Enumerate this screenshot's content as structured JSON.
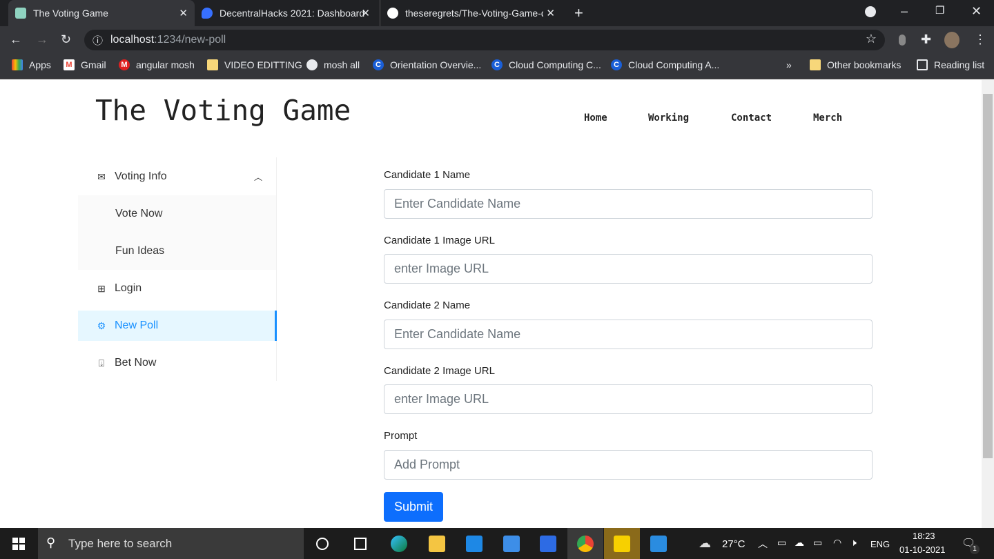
{
  "browser": {
    "tabs": [
      {
        "title": "The Voting Game",
        "active": true,
        "icon": "notion-icon"
      },
      {
        "title": "DecentralHacks 2021: Dashboard",
        "icon": "devfolio-icon"
      },
      {
        "title": "theseregrets/The-Voting-Game-d",
        "icon": "github-icon"
      }
    ],
    "url_host": "localhost",
    "url_path": ":1234/new-poll",
    "bookmarks": [
      "Apps",
      "Gmail",
      "angular mosh",
      "VIDEO EDITTING",
      "mosh all",
      "Orientation Overvie...",
      "Cloud Computing C...",
      "Cloud Computing A..."
    ],
    "other_bookmarks": "Other bookmarks",
    "reading_list": "Reading list",
    "overflow": "»"
  },
  "header": {
    "title": "The Voting Game",
    "nav": [
      "Home",
      "Working",
      "Contact",
      "Merch"
    ]
  },
  "sidebar": {
    "voting_info": "Voting Info",
    "sub_items": [
      "Vote Now",
      "Fun Ideas"
    ],
    "login": "Login",
    "new_poll": "New Poll",
    "bet_now": "Bet Now",
    "selected": "New Poll",
    "accent": "#1890ff"
  },
  "form": {
    "fields": [
      {
        "label": "Candidate 1 Name",
        "placeholder": "Enter Candidate Name"
      },
      {
        "label": "Candidate 1 Image URL",
        "placeholder": "enter Image URL"
      },
      {
        "label": "Candidate 2 Name",
        "placeholder": "Enter Candidate Name"
      },
      {
        "label": "Candidate 2 Image URL",
        "placeholder": "enter Image URL"
      },
      {
        "label": "Prompt",
        "placeholder": "Add Prompt"
      }
    ],
    "submit": "Submit",
    "submit_color": "#0d6efd"
  },
  "taskbar": {
    "search_placeholder": "Type here to search",
    "temp": "27°C",
    "lang": "ENG",
    "time": "18:23",
    "date": "01-10-2021",
    "notifications": "1"
  }
}
